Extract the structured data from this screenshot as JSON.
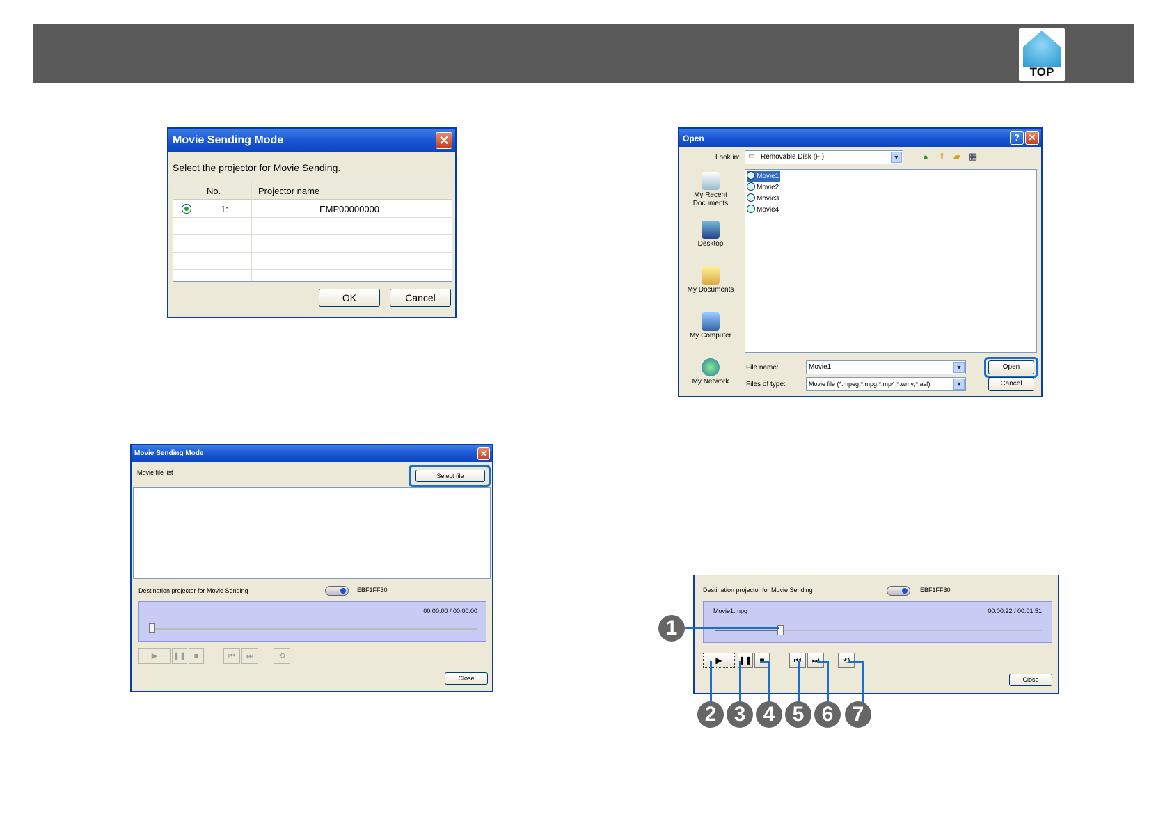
{
  "header": {
    "top_label": "TOP"
  },
  "dialog1": {
    "title": "Movie Sending Mode",
    "prompt": "Select the projector for Movie Sending.",
    "col_no": "No.",
    "col_name": "Projector name",
    "rows": [
      {
        "no": "1:",
        "name": "EMP00000000"
      }
    ],
    "ok": "OK",
    "cancel": "Cancel"
  },
  "dialog2": {
    "title": "Movie Sending Mode",
    "list_label": "Movie file list",
    "select_file": "Select file",
    "dest_label": "Destination projector for Movie Sending",
    "projector": "EBF1FF30",
    "time": "00:00:00 / 00:00:00",
    "close": "Close"
  },
  "open_dialog": {
    "title": "Open",
    "look_in_label": "Look in:",
    "look_in_value": "Removable Disk (F:)",
    "places": [
      "My Recent Documents",
      "Desktop",
      "My Documents",
      "My Computer",
      "My Network"
    ],
    "files": [
      "Movie1",
      "Movie2",
      "Movie3",
      "Movie4"
    ],
    "file_name_label": "File name:",
    "file_name_value": "Movie1",
    "file_type_label": "Files of type:",
    "file_type_value": "Movie file (*.mpeg;*.mpg;*.mp4;*.wmv;*.asf)",
    "open": "Open",
    "cancel": "Cancel"
  },
  "player": {
    "dest_label": "Destination projector for Movie Sending",
    "projector": "EBF1FF30",
    "file": "Movie1.mpg",
    "time": "00:00:22 / 00:01:51",
    "progress": 0.2,
    "close": "Close",
    "callouts": [
      "1",
      "2",
      "3",
      "4",
      "5",
      "6",
      "7"
    ]
  }
}
